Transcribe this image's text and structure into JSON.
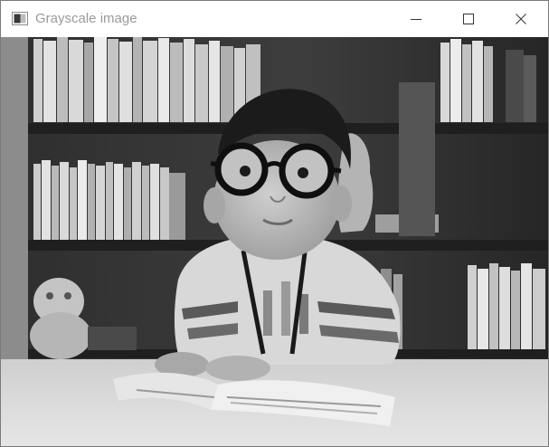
{
  "window": {
    "title": "Grayscale image",
    "icon": "app-window-icon"
  },
  "controls": {
    "minimize_icon": "minimize-icon",
    "maximize_icon": "maximize-icon",
    "close_icon": "close-icon"
  },
  "image": {
    "mode": "grayscale",
    "colors": {
      "background_dark": "#2a2a2a",
      "shelf": "#3a3a3a",
      "carpet": "#dedede",
      "skin": "#bdbdbd",
      "hair": "#1b1b1b"
    }
  }
}
